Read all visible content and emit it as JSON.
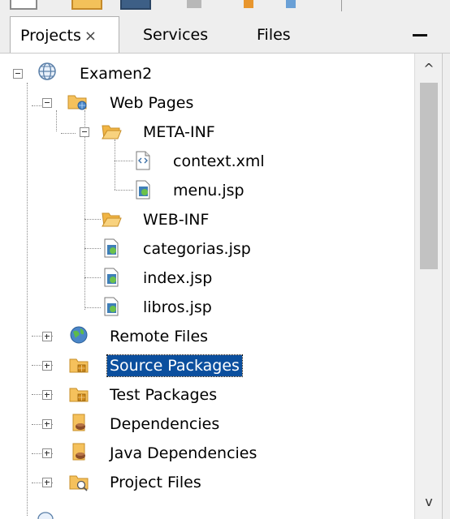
{
  "tabs": [
    {
      "label": "Projects",
      "close": "×",
      "active": true
    },
    {
      "label": "Services",
      "active": false
    },
    {
      "label": "Files",
      "active": false
    }
  ],
  "tree": {
    "root": "Examen2",
    "web_pages": "Web Pages",
    "meta_inf": "META-INF",
    "context_xml": "context.xml",
    "menu_jsp": "menu.jsp",
    "web_inf": "WEB-INF",
    "categorias_jsp": "categorias.jsp",
    "index_jsp": "index.jsp",
    "libros_jsp": "libros.jsp",
    "remote_files": "Remote Files",
    "source_packages": "Source Packages",
    "test_packages": "Test Packages",
    "dependencies": "Dependencies",
    "java_dependencies": "Java Dependencies",
    "project_files": "Project Files"
  },
  "selected_item": "Source Packages",
  "scroll": {
    "up": "^",
    "down": "v"
  },
  "colors": {
    "selection": "#0b4f9e",
    "folder": "#f5c15c",
    "globe": "#4a86c8"
  }
}
